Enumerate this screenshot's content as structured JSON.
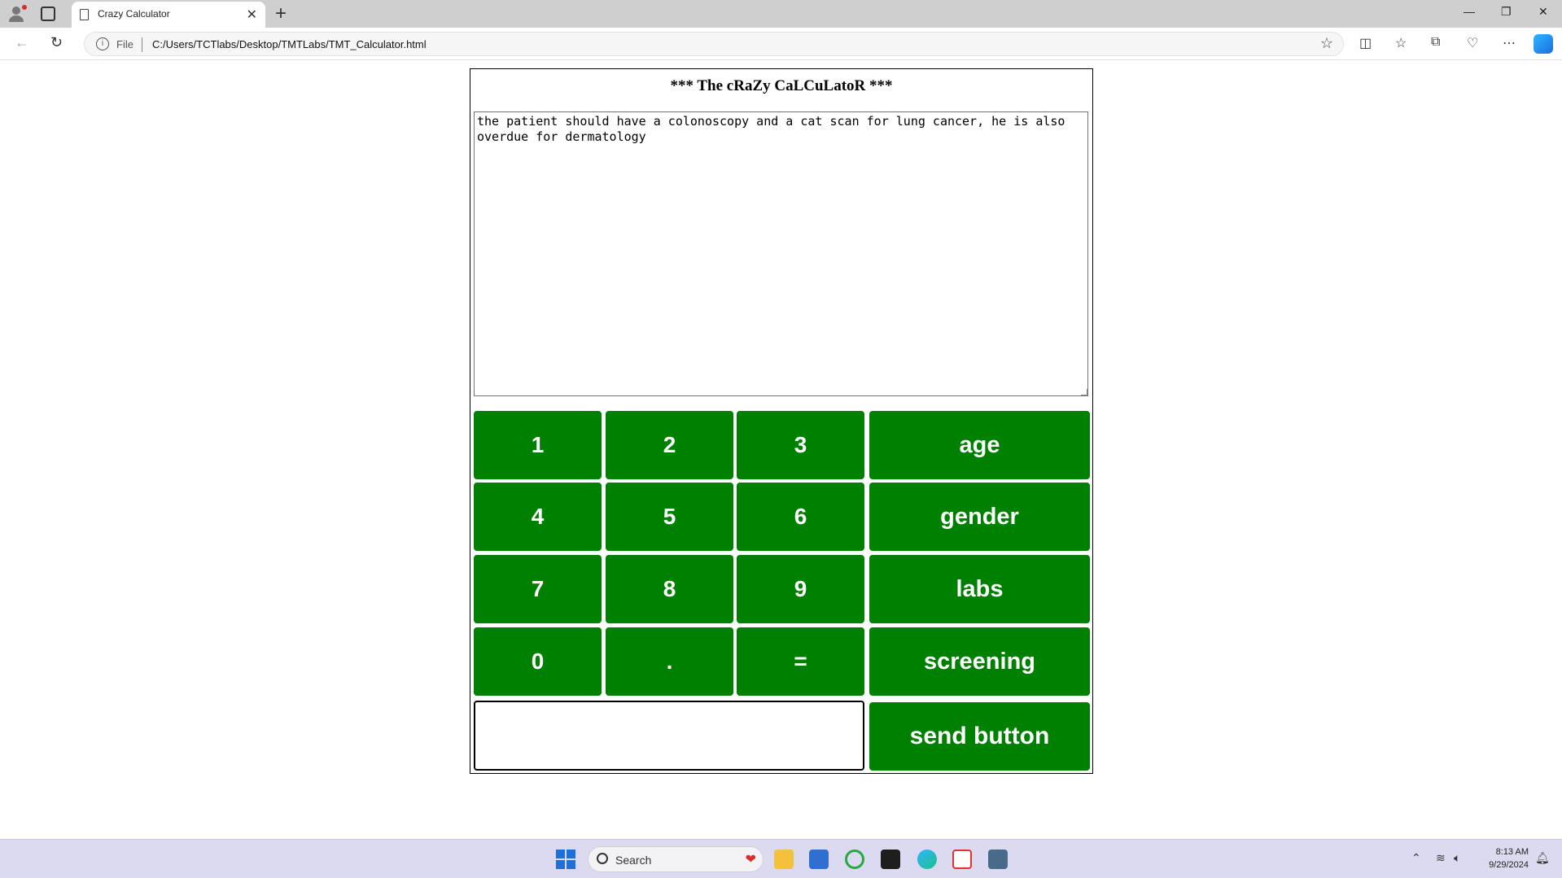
{
  "browser": {
    "tab_title": "Crazy Calculator",
    "address_scheme": "File",
    "url": "C:/Users/TCTlabs/Desktop/TMTLabs/TMT_Calculator.html"
  },
  "calculator": {
    "title": "*** The cRaZy CaLCuLatoR ***",
    "display_text": "the patient should have a colonoscopy and a cat scan for lung cancer, he is also overdue for dermatology",
    "keys": {
      "k1": "1",
      "k2": "2",
      "k3": "3",
      "k4": "4",
      "k5": "5",
      "k6": "6",
      "k7": "7",
      "k8": "8",
      "k9": "9",
      "k0": "0",
      "dot": ".",
      "eq": "="
    },
    "actions": {
      "age": "age",
      "gender": "gender",
      "labs": "labs",
      "screening": "screening"
    },
    "message_value": "",
    "send_label": "send button",
    "button_color": "#008000"
  },
  "taskbar": {
    "search_placeholder": "Search",
    "time": "8:13 AM",
    "date": "9/29/2024"
  }
}
